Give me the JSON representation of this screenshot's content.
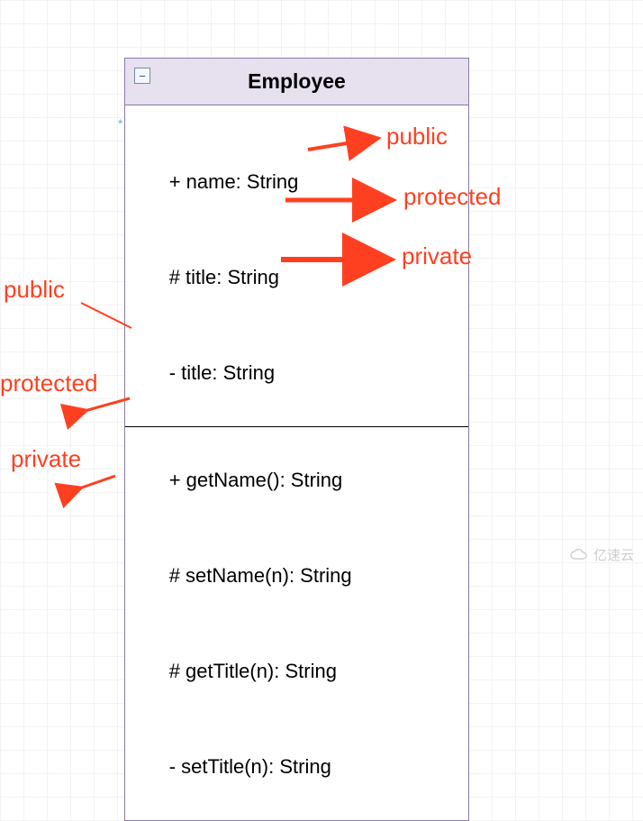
{
  "uml": {
    "class_name": "Employee",
    "collapse_icon": "−",
    "attributes": [
      {
        "text": "+ name: String",
        "visibility": "public"
      },
      {
        "text": "# title: String",
        "visibility": "protected"
      },
      {
        "text": "- title: String",
        "visibility": "private"
      }
    ],
    "methods": [
      {
        "text": "+ getName(): String",
        "visibility": "public"
      },
      {
        "text": "# setName(n): String",
        "visibility": "protected"
      },
      {
        "text": "# getTitle(n): String",
        "visibility": "protected"
      },
      {
        "text": "- setTitle(n): String",
        "visibility": "private"
      }
    ]
  },
  "annotations": {
    "right_public": "public",
    "right_protected": "protected",
    "right_private": "private",
    "left_public": "public",
    "left_protected": "protected",
    "left_private": "private"
  },
  "watermark": "亿速云",
  "colors": {
    "annotation": "#ff4020",
    "header_bg": "#e6e0ef",
    "border": "#8a7aa8"
  }
}
